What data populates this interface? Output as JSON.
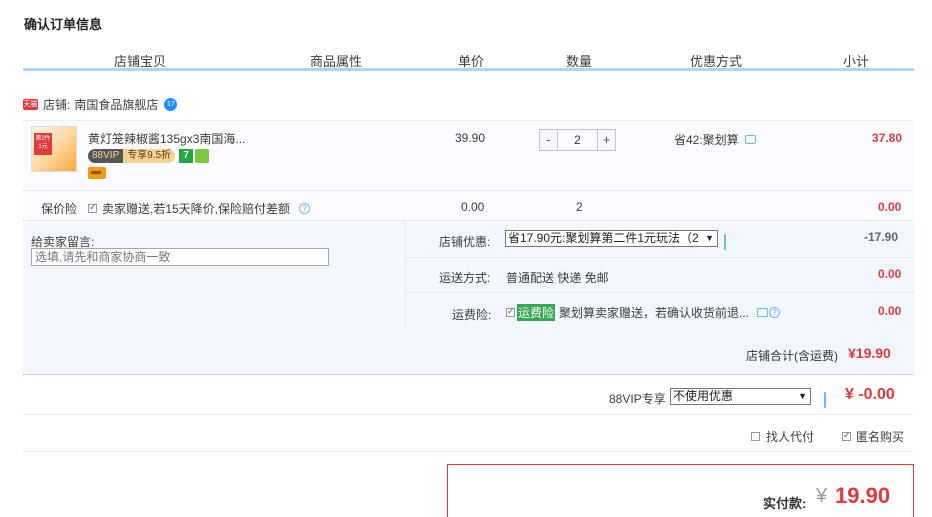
{
  "page_title": "确认订单信息",
  "columns": [
    "店铺宝贝",
    "商品属性",
    "单价",
    "数量",
    "优惠方式",
    "小计"
  ],
  "shop": {
    "label": "店铺:",
    "name": "南国食品旗舰店",
    "badge_text": "天猫",
    "ww_badge": "17"
  },
  "item": {
    "name": "黄灯笼辣椒酱135gx3南国海...",
    "vip_label": "88VIP",
    "vip_discount": "专享9.5折",
    "icon7": "7",
    "thumb_tag": "第2件 1元",
    "price": "39.90",
    "quantity": "2",
    "minus": "-",
    "plus": "+",
    "promo": "省42:聚划算",
    "subtotal": "37.80"
  },
  "insurance": {
    "label": "保价险",
    "desc": "卖家赠送,若15天降价,保险赔付差额",
    "price": "0.00",
    "qty": "2",
    "subtotal": "0.00"
  },
  "message": {
    "label": "给卖家留言:",
    "placeholder": "选填,请先和商家协商一致"
  },
  "shop_discount": {
    "label": "店铺优惠:",
    "selected": "省17.90元:聚划算第二件1元玩法（2",
    "amount": "-17.90"
  },
  "shipping": {
    "label": "运送方式:",
    "desc": "普通配送 快递 免邮",
    "amount": "0.00"
  },
  "freight_insurance": {
    "label": "运费险:",
    "tag": "运费险",
    "desc": "聚划算卖家赠送，若确认收货前退...",
    "amount": "0.00"
  },
  "shop_total": {
    "label": "店铺合计(含运费)",
    "amount": "¥19.90"
  },
  "vip": {
    "label": "88VIP专享",
    "selected": "不使用优惠",
    "amount": "¥ -0.00"
  },
  "options": {
    "proxy_pay": "找人代付",
    "anonymous": "匿名购买"
  },
  "payment": {
    "label": "实付款:",
    "currency": "¥",
    "amount": "19.90"
  },
  "colors": {
    "accent_red": "#e4393c",
    "header_line": "#b2d1ff",
    "panel_bg": "#f2f7ff"
  }
}
